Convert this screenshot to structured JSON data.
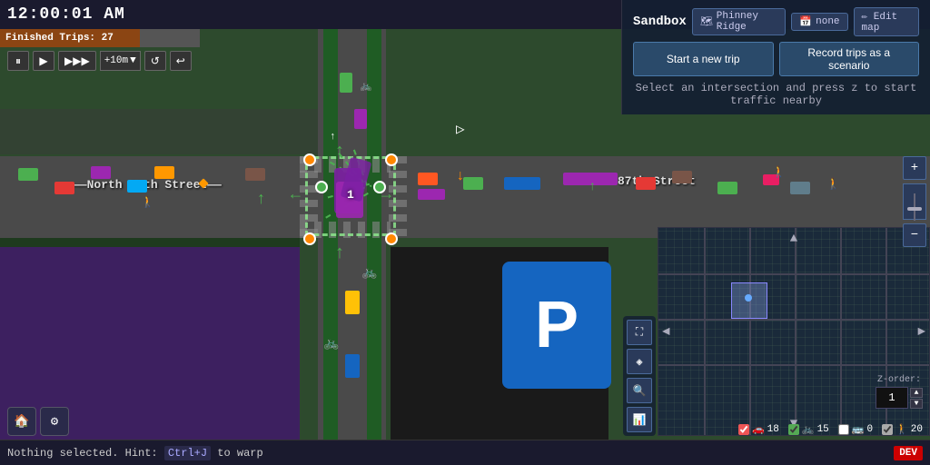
{
  "clock": {
    "time": "12:00:01 AM"
  },
  "finished_trips": {
    "label": "Finished Trips: 27"
  },
  "controls": {
    "pause_label": "⏸",
    "play_label": "▶",
    "fast_forward_label": "▶▶▶",
    "speed_label": "+10m",
    "reset_label": "↺",
    "undo_label": "↩"
  },
  "sandbox": {
    "title": "Sandbox",
    "map_icon": "🗺",
    "location": "Phinney Ridge",
    "scenario": "none",
    "edit_map_label": "✏ Edit map"
  },
  "action_buttons": {
    "new_trip": "Start a new trip",
    "record_scenario": "Record trips as a scenario"
  },
  "hint": {
    "text": "Select an intersection and press z to start traffic nearby"
  },
  "streets": {
    "north_87th": "North 87th Street",
    "east_87th": "87th Street"
  },
  "map_tools": {
    "fullscreen": "⛶",
    "layers": "◈",
    "search": "🔍",
    "chart": "📊"
  },
  "minimap_controls": {
    "zoom_in": "+",
    "zoom_out": "−",
    "nav_up": "▲",
    "nav_down": "▼",
    "nav_left": "◀",
    "nav_right": "▶"
  },
  "z_order": {
    "label": "Z-order:",
    "value": "1"
  },
  "legend": {
    "cars": {
      "checked": true,
      "icon": "🚗",
      "count": "18"
    },
    "bikes": {
      "checked": true,
      "icon": "🚲",
      "count": "15"
    },
    "buses": {
      "checked": false,
      "icon": "🚌",
      "count": "0"
    },
    "pedestrians": {
      "checked": true,
      "icon": "🚶",
      "count": "20"
    }
  },
  "bottom_icons": {
    "home": "🏠",
    "settings": "⚙"
  },
  "status": {
    "text": "Nothing selected.",
    "hint_prefix": "Hint:",
    "hint_key": "Ctrl+J",
    "hint_suffix": "to warp"
  },
  "dev_badge": "DEV",
  "parking": {
    "letter": "P"
  }
}
